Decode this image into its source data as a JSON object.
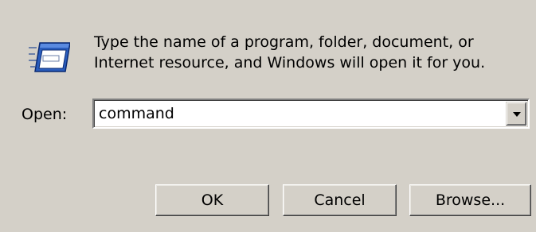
{
  "dialog": {
    "icon": "run-program-icon",
    "description_line1": "Type the name of a program, folder, document, or",
    "description_line2": "Internet resource, and Windows will open it for you.",
    "open_label": "Open:",
    "open_value": "command",
    "buttons": {
      "ok": "OK",
      "cancel": "Cancel",
      "browse": "Browse..."
    }
  },
  "colors": {
    "background": "#d4d0c8",
    "window_face": "#ffffff",
    "icon_blue": "#2a5dbd"
  }
}
